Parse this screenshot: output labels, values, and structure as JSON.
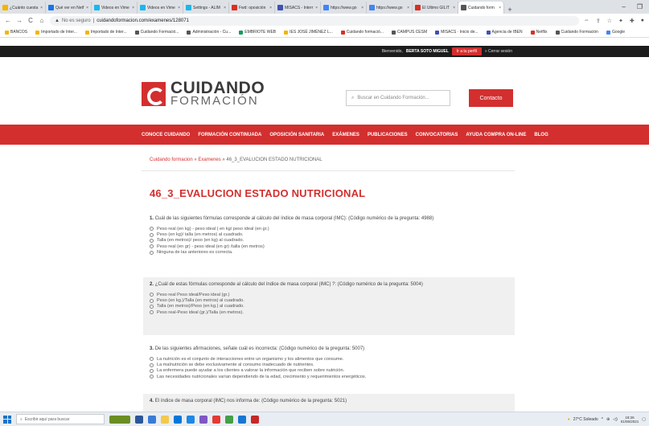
{
  "browser": {
    "tabs": [
      {
        "label": "¿Cuánto cuesta",
        "color": "#f4b400"
      },
      {
        "label": "Qué ver en Netf",
        "color": "#1a73e8"
      },
      {
        "label": "Videos en Vime",
        "color": "#1ab7ea"
      },
      {
        "label": "Videos en Vime",
        "color": "#1ab7ea"
      },
      {
        "label": "Settings - ALIM",
        "color": "#1ab7ea"
      },
      {
        "label": "Fwd: oposición",
        "color": "#d93025"
      },
      {
        "label": "MISACS - Interr",
        "color": "#3f51b5"
      },
      {
        "label": "https://www.go",
        "color": "#4285f4"
      },
      {
        "label": "https://www.go",
        "color": "#4285f4"
      },
      {
        "label": "El Último GILIT",
        "color": "#d93025"
      },
      {
        "label": "Cuidando form",
        "color": "#555555"
      }
    ],
    "url_security": "No es seguro",
    "url": "cuidandoformacion.com/examenes/128071",
    "bookmarks": [
      {
        "label": "BANCOS",
        "color": "#f4b400"
      },
      {
        "label": "Importado de Inter...",
        "color": "#f4b400"
      },
      {
        "label": "Importado de Inter...",
        "color": "#f4b400"
      },
      {
        "label": "Cuidando Formació...",
        "color": "#555555"
      },
      {
        "label": "Administración - Cu...",
        "color": "#555555"
      },
      {
        "label": "EMBRIOTE WEB",
        "color": "#0f9d58"
      },
      {
        "label": "IES JOSÉ JIMÉNEZ L...",
        "color": "#f4b400"
      },
      {
        "label": "Cuidando formació...",
        "color": "#d93025"
      },
      {
        "label": "CAMPUS CESM",
        "color": "#555555"
      },
      {
        "label": "MISACS · Inicio de...",
        "color": "#3f51b5"
      },
      {
        "label": "Agencia de IBEN",
        "color": "#3f51b5"
      },
      {
        "label": "Netflix",
        "color": "#d93025"
      },
      {
        "label": "Cuidando Formación",
        "color": "#555555"
      },
      {
        "label": "Google",
        "color": "#4285f4"
      }
    ]
  },
  "site": {
    "welcome": "Bienvenido,",
    "user": "BERTA SOTO MIGUEL",
    "profile_btn": "Ir a tu perfil",
    "logout": "» Cerrar sesión",
    "logo_line1": "CUIDANDO",
    "logo_line2": "FORMACIÓN",
    "search_placeholder": "Buscar en Cuidando Formación...",
    "contact": "Contacto",
    "nav": [
      "CONOCE CUIDANDO",
      "FORMACIÓN CONTINUADA",
      "OPOSICIÓN SANITARIA",
      "EXÁMENES",
      "PUBLICACIONES",
      "CONVOCATORIAS",
      "AYUDA COMPRA ON-LINE",
      "BLOG"
    ],
    "breadcrumb": {
      "home": "Cuidando formacion",
      "section": "Examenes",
      "current": "» 46_3_EVALUCION ESTADO NUTRICIONAL"
    },
    "title": "46_3_EVALUCION ESTADO NUTRICIONAL"
  },
  "questions": [
    {
      "num": "1.",
      "text": "Cuál de las siguientes fórmulas corresponde al cálculo del índice de masa corporal (IMC): (Código numérico de la pregunta: 4988)",
      "options": [
        "Peso real (en kg) - peso ideal ( en kg/ peso ideal (en gr.)",
        "Peso (en kg)/ talla (en metros) al cuadrado.",
        "Talla (en metros)/ peso (en kg) al cuadrado.",
        "Peso real (en gr) - peso ideal (en gr) /talla (en metros)",
        "Ninguna de las anteriores es correcta."
      ]
    },
    {
      "num": "2.",
      "text": "¿Cuál de estas fórmulas corresponde al cálculo del índice de masa corporal (IMC) ?: (Código numérico de la pregunta: 5004)",
      "options": [
        "Peso real Peso ideal/Peso ideal (gr.)",
        "Peso (en kg.)/Talla (en metros) al cuadrado.",
        "Talla (en metros)/Peso (en kg.) al cuadrado.",
        "Peso real-Peso ideal (gr.)/Talla (en metros)."
      ]
    },
    {
      "num": "3.",
      "text": "De las siguientes afirmaciones, señale cuál es incorrecta: (Código numérico de la pregunta: 5007)",
      "options": [
        "La nutrición es el conjunto de interacciones entre un organismo y los alimentos que consume.",
        "La malnutrición se debe exclusivamente al consumo inadecuado de nutrientes.",
        "La enfermera puede ayudar a los clientes a valorar la información que reciben sobre nutrición.",
        "Las necesidades nutricionales varían dependiendo de la edad, crecimiento y requerimientos energéticos."
      ]
    },
    {
      "num": "4.",
      "text": "El índice de masa corporal (IMC) nos informa de: (Código numérico de la pregunta: 5021)",
      "options": []
    }
  ],
  "taskbar": {
    "search": "Escribir aquí para buscar",
    "weather": "27°C Soleado",
    "time": "18:26",
    "date": "01/06/2021"
  }
}
